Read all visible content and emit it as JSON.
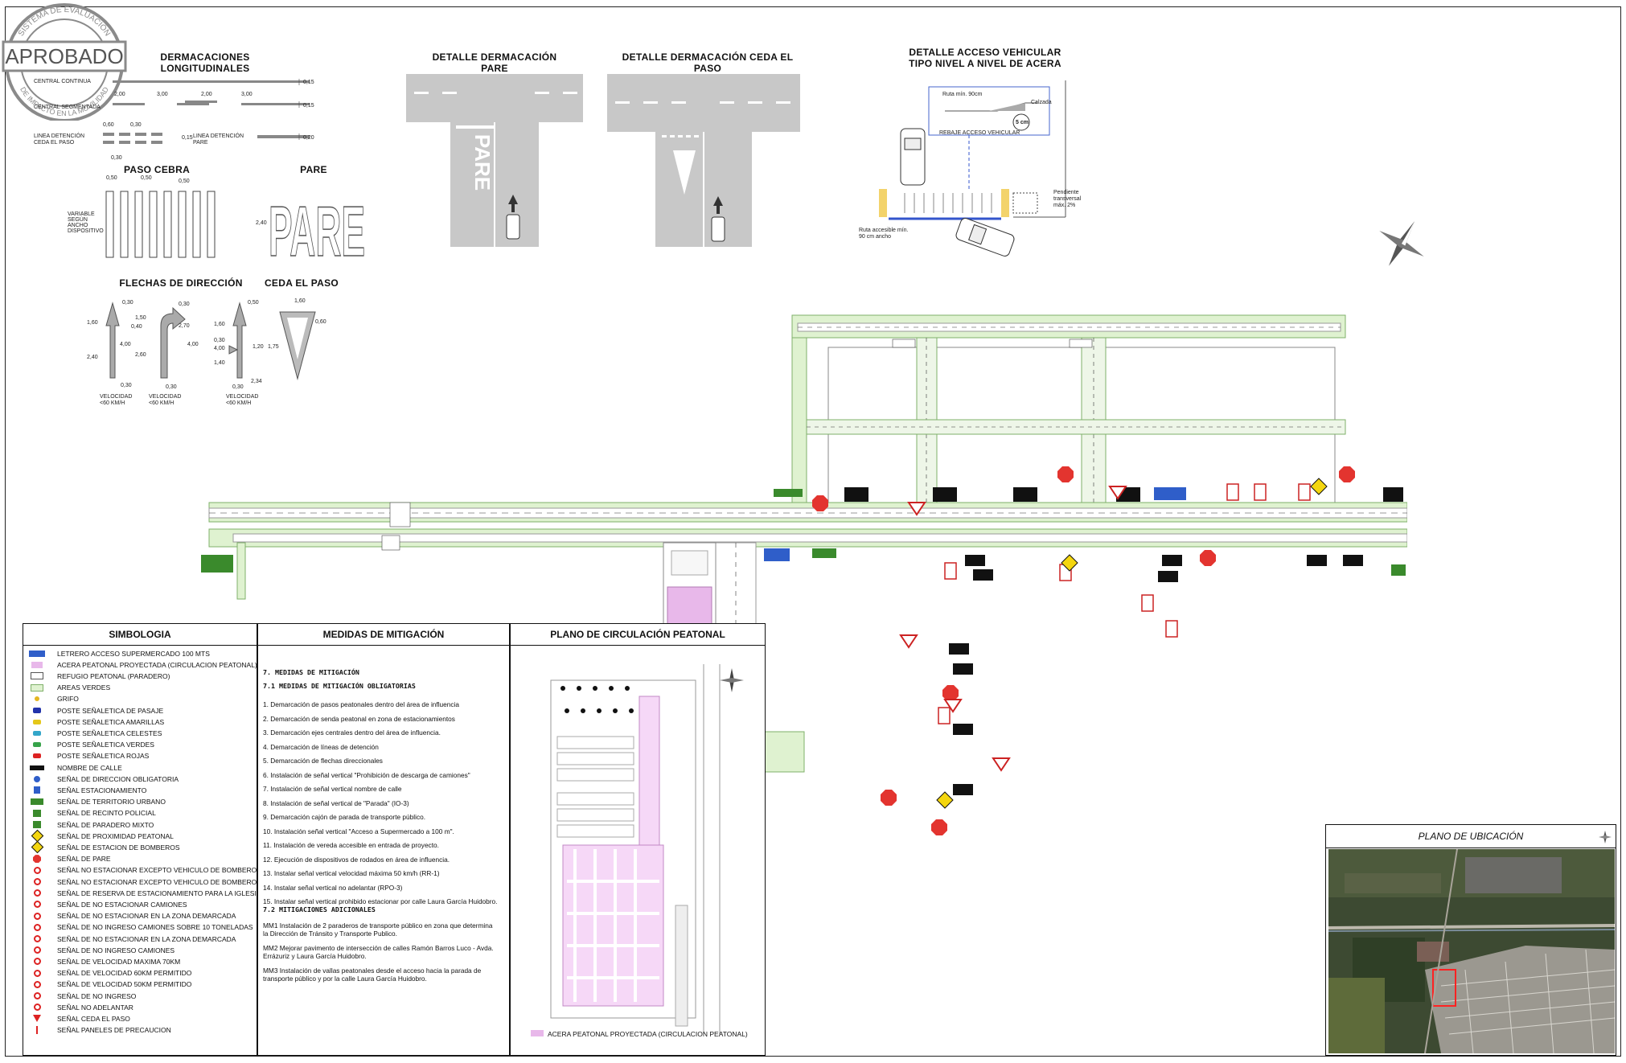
{
  "stamp": {
    "main": "APROBADO",
    "ring_top": "SISTEMA DE EVALUACIÓN",
    "ring_bottom": "DE IMPACTO EN LA MOVILIDAD"
  },
  "sections": {
    "dermarcaciones_longitudinales": "DERMACACIONES LONGITUDINALES",
    "detalle_pare": "DETALLE DERMACACIÓN PARE",
    "detalle_ceda": "DETALLE DERMACACIÓN CEDA EL PASO",
    "detalle_acceso_1": "DETALLE ACCESO VEHICULAR",
    "detalle_acceso_2": "TIPO NIVEL A NIVEL DE ACERA",
    "paso_cebra": "PASO CEBRA",
    "pare": "PARE",
    "flechas": "FLECHAS DE DIRECCIÓN",
    "ceda": "CEDA EL PASO"
  },
  "longitudinal": {
    "central_continua": "CENTRAL CONTINUA",
    "central_segmentada": "CENTRAL SEGMENTADA",
    "linea_ceda_1": "LINEA DETENCIÓN",
    "linea_ceda_2": "CEDA EL PASO",
    "linea_pare_1": "LINEA DETENCIÓN",
    "linea_pare_2": "PARE",
    "d1": "0,15",
    "d2": "0,15",
    "d3": "0,20",
    "d4": "0,15",
    "seg1": "2,00",
    "seg2": "3,00",
    "seg3": "2,00",
    "seg4": "3,00",
    "c1": "0,60",
    "c2": "0,30",
    "c3": "0,30"
  },
  "cebra": {
    "variable": [
      "VARIABLE",
      "SEGÚN",
      "ANCHO",
      "DISPOSITIVO"
    ],
    "dims": [
      "0,50",
      "0,50",
      "0,50"
    ]
  },
  "pare_word": {
    "text": "PARE",
    "height": "2,40"
  },
  "pare_detail": {
    "text": "PARE"
  },
  "flechas": {
    "velocidad": [
      "VELOCIDAD",
      "<60 KM/H"
    ],
    "d_left": [
      "0,30",
      "1,60",
      "4,00",
      "2,40",
      "0,30"
    ],
    "d_mid": [
      "0,30",
      "1,50",
      "0,40",
      "2,70",
      "4,00",
      "2,60",
      "0,30"
    ],
    "d_right": [
      "0,50",
      "1,60",
      "0,30",
      "1,20",
      "4,00",
      "1,40",
      "2,34",
      "0,30",
      "1,75"
    ]
  },
  "ceda_sign": {
    "w": "1,60",
    "h": "0,60"
  },
  "acceso": {
    "ruta": "Ruta mín. 90cm",
    "calzada": "Calzada",
    "cm": "5 cm",
    "rebaje": "REBAJE ACCESO VEHICULAR",
    "pendiente": [
      "Pendiente",
      "transversal",
      "máx. 2%"
    ],
    "accesible": [
      "Ruta accesible mín.",
      "90 cm ancho"
    ]
  },
  "simbologia": {
    "title": "SIMBOLOGIA",
    "items": [
      {
        "label": "LETRERO ACCESO SUPERMERCADO 100 MTS",
        "icon": "blue-board-icon"
      },
      {
        "label": "ACERA PEATONAL PROYECTADA (CIRCULACION PEATONAL)",
        "icon": "pink-area-icon"
      },
      {
        "label": "REFUGIO PEATONAL (PARADERO)",
        "icon": "white-box-icon"
      },
      {
        "label": "AREAS VERDES",
        "icon": "green-area-icon"
      },
      {
        "label": "GRIFO",
        "icon": "hydrant-icon"
      },
      {
        "label": "POSTE SEÑALETICA DE PASAJE",
        "icon": "blue-post-icon"
      },
      {
        "label": "POSTE SEÑALETICA AMARILLAS",
        "icon": "yellow-post-icon"
      },
      {
        "label": "POSTE SEÑALETICA CELESTES",
        "icon": "cyan-post-icon"
      },
      {
        "label": "POSTE SEÑALETICA VERDES",
        "icon": "green-post-icon"
      },
      {
        "label": "POSTE SEÑALETICA ROJAS",
        "icon": "red-post-icon"
      },
      {
        "label": "NOMBRE DE CALLE",
        "icon": "street-name-icon"
      },
      {
        "label": "SEÑAL DE DIRECCION OBLIGATORIA",
        "icon": "mandatory-direction-icon"
      },
      {
        "label": "SEÑAL ESTACIONAMIENTO",
        "icon": "parking-sign-icon"
      },
      {
        "label": "SEÑAL DE TERRITORIO URBANO",
        "icon": "urban-territory-icon"
      },
      {
        "label": "SEÑAL DE RECINTO POLICIAL",
        "icon": "police-sign-icon"
      },
      {
        "label": "SEÑAL DE PARADERO MIXTO",
        "icon": "bus-stop-sign-icon"
      },
      {
        "label": "SEÑAL DE PROXIMIDAD PEATONAL",
        "icon": "pedestrian-warning-icon"
      },
      {
        "label": "SEÑAL DE ESTACION DE BOMBEROS",
        "icon": "fire-station-icon"
      },
      {
        "label": "SEÑAL DE PARE",
        "icon": "stop-sign-icon"
      },
      {
        "label": "SEÑAL NO ESTACIONAR EXCEPTO VEHICULO DE BOMBEROS",
        "icon": "no-parking-fire-icon"
      },
      {
        "label": "SEÑAL NO ESTACIONAR EXCEPTO VEHICULO DE BOMBEROS",
        "icon": "no-parking-fire-icon"
      },
      {
        "label": "SEÑAL DE RESERVA DE ESTACIONAMIENTO PARA LA IGLESIA",
        "icon": "church-parking-icon"
      },
      {
        "label": "SEÑAL DE NO ESTACIONAR CAMIONES",
        "icon": "no-truck-parking-icon"
      },
      {
        "label": "SEÑAL DE NO ESTACIONAR EN LA ZONA DEMARCADA",
        "icon": "no-parking-zone-icon"
      },
      {
        "label": "SEÑAL DE NO INGRESO CAMIONES SOBRE 10 TONELADAS",
        "icon": "no-truck-entry-icon"
      },
      {
        "label": "SEÑAL DE NO ESTACIONAR EN LA ZONA DEMARCADA",
        "icon": "no-parking-zone-icon"
      },
      {
        "label": "SEÑAL DE NO INGRESO CAMIONES",
        "icon": "no-truck-entry-icon"
      },
      {
        "label": "SEÑAL DE VELOCIDAD MAXIMA 70KM",
        "icon": "speed-70-icon"
      },
      {
        "label": "SEÑAL DE VELOCIDAD  60KM PERMITIDO",
        "icon": "speed-60-icon"
      },
      {
        "label": "SEÑAL DE VELOCIDAD  50KM PERMITIDO",
        "icon": "speed-50-icon"
      },
      {
        "label": "SEÑAL DE NO INGRESO",
        "icon": "no-entry-icon"
      },
      {
        "label": "SEÑAL NO ADELANTAR",
        "icon": "no-overtaking-icon"
      },
      {
        "label": "SEÑAL CEDA EL PASO",
        "icon": "yield-sign-icon"
      },
      {
        "label": "SEÑAL PANELES DE PRECAUCION",
        "icon": "caution-panel-icon"
      }
    ]
  },
  "mitigacion": {
    "title": "MEDIDAS DE MITIGACIÓN",
    "h1": "7. MEDIDAS DE MITIGACIÓN",
    "h2": "7.1 MEDIDAS DE MITIGACIÓN OBLIGATORIAS",
    "items": [
      "1. Demarcación de pasos peatonales dentro del área de influencia",
      "2. Demarcación de senda peatonal en zona de estacionamientos",
      "3. Demarcación ejes centrales dentro del área de influencia.",
      "4. Demarcación de líneas de detención",
      "5. Demarcación de flechas direccionales",
      "6. Instalación de señal vertical \"Prohibición de descarga de camiones\"",
      "7. Instalación de señal vertical nombre de calle",
      "8. Instalación de señal vertical de \"Parada\" (IO-3)",
      "9. Demarcación cajón de parada de transporte público.",
      "10. Instalación señal vertical \"Acceso a Supermercado a 100 m\".",
      "11. Instalación de vereda accesible en entrada de proyecto.",
      "12. Ejecución de dispositivos de rodados en área de influencia.",
      "13. Instalar señal vertical velocidad máxima 50 km/h (RR-1)",
      "14. Instalar señal vertical no adelantar (RPO-3)",
      "15. Instalar señal vertical prohibido estacionar por calle Laura García Huidobro."
    ],
    "h3": "7.2 MITIGACIONES ADICIONALES",
    "extra": [
      [
        "MM1 Instalación de 2 paraderos de transporte público en zona que determina",
        "la Dirección de Tránsito y Transporte Publico."
      ],
      [
        "MM2 Mejorar pavimento de intersección de calles Ramón Barros Luco - Avda.",
        "Errázuriz y Laura García Huidobro."
      ],
      [
        "MM3 Instalación de vallas peatonales desde el acceso hacia la parada de",
        "transporte público y por la calle Laura García Huidobro."
      ]
    ]
  },
  "circulacion": {
    "title": "PLANO DE CIRCULACIÓN PEATONAL",
    "legend": "ACERA PEATONAL PROYECTADA (CIRCULACION PEATONAL)"
  },
  "ubicacion": {
    "title": "PLANO DE UBICACIÓN"
  },
  "colors": {
    "green_area": "#dff2d0",
    "green_stroke": "#7fb06a",
    "pink": "#e8b8ea",
    "stop_red": "#e3342f",
    "blue_sign": "#2f5ec9",
    "yellow_sign": "#f4d60f",
    "asphalt": "#c8c8c8"
  }
}
